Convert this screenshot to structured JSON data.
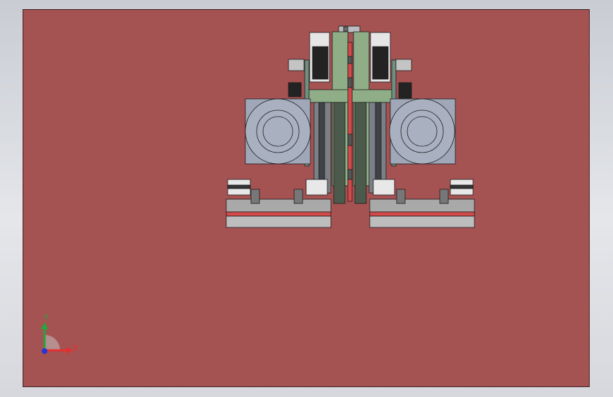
{
  "viewport": {
    "background_color": "#a55252",
    "surround_color": "#d6d8dd"
  },
  "model": {
    "description_colors": {
      "frame_green": "#8fae87",
      "frame_dark": "#2d3a2c",
      "motor_dark": "#232323",
      "rail_gray": "#7b7f86",
      "drum_gray": "#9fa7b8",
      "accent_red": "#d24a4a"
    }
  },
  "triad": {
    "x_label": "X",
    "y_label": "Y",
    "x_color": "#e23030",
    "y_color": "#21a73a",
    "z_color": "#2434d8"
  }
}
